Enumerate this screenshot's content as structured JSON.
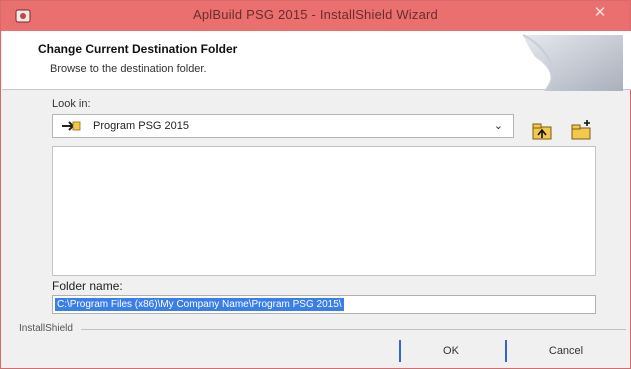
{
  "window": {
    "title": "AplBuild PSG 2015 - InstallShield Wizard",
    "close_glyph": "✕"
  },
  "header": {
    "title": "Change Current Destination Folder",
    "subtitle": "Browse to the destination folder."
  },
  "look_in": {
    "label": "Look in:",
    "selected": "Program PSG 2015"
  },
  "folder_name": {
    "label": "Folder name:",
    "value": "C:\\Program Files (x86)\\My Company Name\\Program PSG 2015\\"
  },
  "footer": {
    "brand": "InstallShield",
    "ok_label": "OK",
    "cancel_label": "Cancel"
  },
  "colors": {
    "titlebar": "#ea6f6f",
    "selection": "#3a7ee8",
    "button_accent": "#3a63c8"
  },
  "icons": {
    "app": "installer-app-icon",
    "select": "folder-arrow-icon",
    "up_folder": "up-one-level-icon",
    "new_folder": "new-folder-icon"
  }
}
